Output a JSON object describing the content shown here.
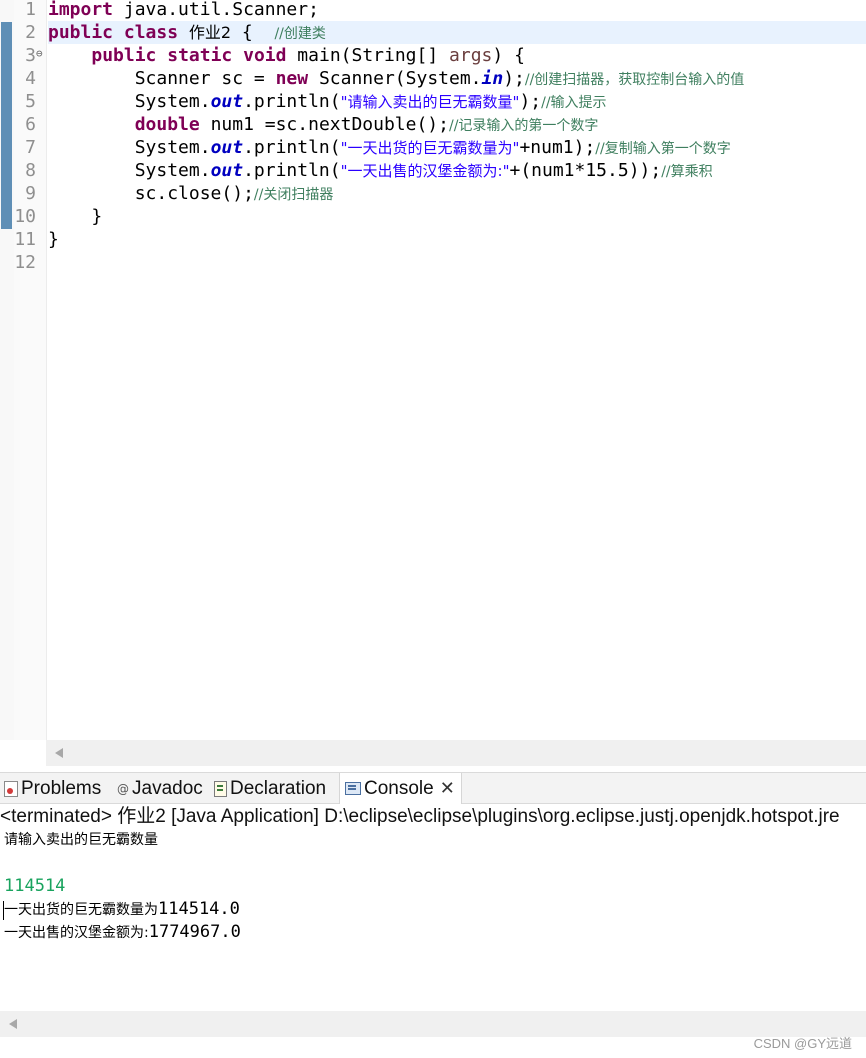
{
  "editor": {
    "line_numbers": [
      "1",
      "2",
      "3",
      "4",
      "5",
      "6",
      "7",
      "8",
      "9",
      "10",
      "11",
      "12"
    ],
    "fold_marker": "⊖",
    "code": {
      "l1": {
        "kw": "import",
        "rest": " java.util.Scanner;"
      },
      "l2": {
        "kw1": "public",
        "kw2": "class",
        "name": "作业2",
        "brace": " {  ",
        "comment": "//创建类"
      },
      "l3": {
        "kw1": "public",
        "kw2": "static",
        "kw3": "void",
        "sig_a": " main(String[] ",
        "param": "args",
        "sig_b": ") {"
      },
      "l4": {
        "a": "Scanner sc = ",
        "kw": "new",
        "b": " Scanner(System.",
        "fld": "in",
        "c": ");",
        "comment": "//创建扫描器，获取控制台输入的值"
      },
      "l5": {
        "a": "System.",
        "fld": "out",
        "b": ".println(",
        "str": "\"请输入卖出的巨无霸数量\"",
        "c": ");",
        "comment": "//输入提示"
      },
      "l6": {
        "kw": "double",
        "a": " num1 =sc.nextDouble();",
        "comment": "//记录输入的第一个数字"
      },
      "l7": {
        "a": "System.",
        "fld": "out",
        "b": ".println(",
        "str": "\"一天出货的巨无霸数量为\"",
        "c": "+num1);",
        "comment": "//复制输入第一个数字"
      },
      "l8": {
        "a": "System.",
        "fld": "out",
        "b": ".println(",
        "str": "\"一天出售的汉堡金额为:\"",
        "c": "+(num1*15.5));",
        "comment": "//算乘积"
      },
      "l9": {
        "a": "sc.close();",
        "comment": "//关闭扫描器"
      },
      "l10": "}",
      "l11": "}"
    }
  },
  "tabs": [
    {
      "label": "Problems",
      "icon": "problems-icon"
    },
    {
      "label": "Javadoc",
      "icon": "at-icon"
    },
    {
      "label": "Declaration",
      "icon": "declaration-icon"
    },
    {
      "label": "Console",
      "icon": "console-icon",
      "active": true,
      "close": "✕"
    }
  ],
  "console": {
    "header": "<terminated> 作业2 [Java Application] D:\\eclipse\\eclipse\\plugins\\org.eclipse.justj.openjdk.hotspot.jre",
    "prompt": "请输入卖出的巨无霸数量",
    "input": "114514",
    "out1_label": "一天出货的巨无霸数量为",
    "out1_value": "114514.0",
    "out2_label": "一天出售的汉堡金额为:",
    "out2_value": "1774967.0"
  },
  "watermark": "CSDN @GY远道",
  "colors": {
    "keyword": "#7f0055",
    "string": "#2a00ff",
    "comment": "#3f7f5f",
    "field": "#0000c0",
    "console_input": "#19a35e"
  }
}
